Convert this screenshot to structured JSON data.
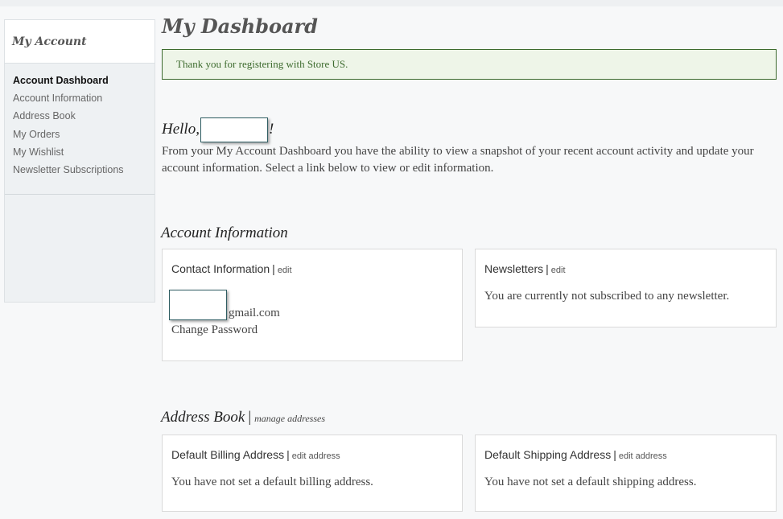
{
  "sidebar": {
    "title": "My Account",
    "items": [
      {
        "label": "Account Dashboard"
      },
      {
        "label": "Account Information"
      },
      {
        "label": "Address Book"
      },
      {
        "label": "My Orders"
      },
      {
        "label": "My Wishlist"
      },
      {
        "label": "Newsletter Subscriptions"
      }
    ]
  },
  "main": {
    "title": "My Dashboard",
    "notice": "Thank you for registering with Store US.",
    "hello_prefix": "Hello,",
    "hello_suffix": "!",
    "intro": "From your My Account Dashboard you have the ability to view a snapshot of your recent account activity and update your account information. Select a link below to view or edit information.",
    "account_info": {
      "title": "Account Information",
      "contact": {
        "title": "Contact Information",
        "separator": "|",
        "edit_label": "edit",
        "email_suffix": "gmail.com",
        "change_password": "Change Password"
      },
      "newsletters": {
        "title": "Newsletters",
        "separator": "|",
        "edit_label": "edit",
        "text": "You are currently not subscribed to any newsletter."
      }
    },
    "address_book": {
      "title": "Address Book",
      "separator": "|",
      "manage_label": "manage addresses",
      "billing": {
        "title": "Default Billing Address",
        "separator": "|",
        "edit_label": "edit address",
        "text": "You have not set a default billing address."
      },
      "shipping": {
        "title": "Default Shipping Address",
        "separator": "|",
        "edit_label": "edit address",
        "text": "You have not set a default shipping address."
      }
    }
  }
}
